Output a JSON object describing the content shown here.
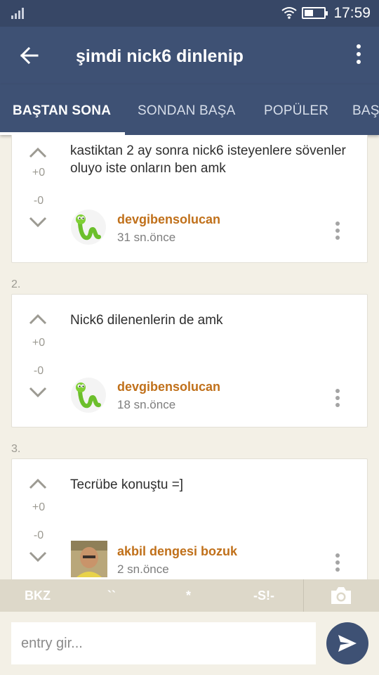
{
  "status_bar": {
    "time": "17:59"
  },
  "header": {
    "title": "şimdi nick6 dinlenip"
  },
  "tabs": [
    {
      "label": "BAŞTAN SONA",
      "active": true
    },
    {
      "label": "SONDAN BAŞA",
      "active": false
    },
    {
      "label": "POPÜLER",
      "active": false
    },
    {
      "label": "BAŞ",
      "active": false
    }
  ],
  "entries": [
    {
      "number": "",
      "plus": "+0",
      "minus": "-0",
      "text": "kastiktan 2 ay sonra nick6 isteyenlere sövenler oluyo iste onların ben amk",
      "author": "devgibensolucan",
      "time": "31 sn.önce"
    },
    {
      "number": "2.",
      "plus": "+0",
      "minus": "-0",
      "text": "Nick6 dilenenlerin de amk",
      "author": "devgibensolucan",
      "time": "18 sn.önce"
    },
    {
      "number": "3.",
      "plus": "+0",
      "minus": "-0",
      "text": "Tecrübe konuştu =]",
      "author": "akbil dengesi bozuk",
      "time": "2 sn.önce"
    }
  ],
  "format_toolbar": {
    "bkz": "BKZ",
    "backticks": "``",
    "star": "*",
    "spoiler": "-S!-"
  },
  "composer": {
    "placeholder": "entry gir..."
  },
  "colors": {
    "primary": "#3e5174",
    "status_bar": "#374766",
    "author": "#c0701a",
    "background": "#f3f0e6"
  }
}
